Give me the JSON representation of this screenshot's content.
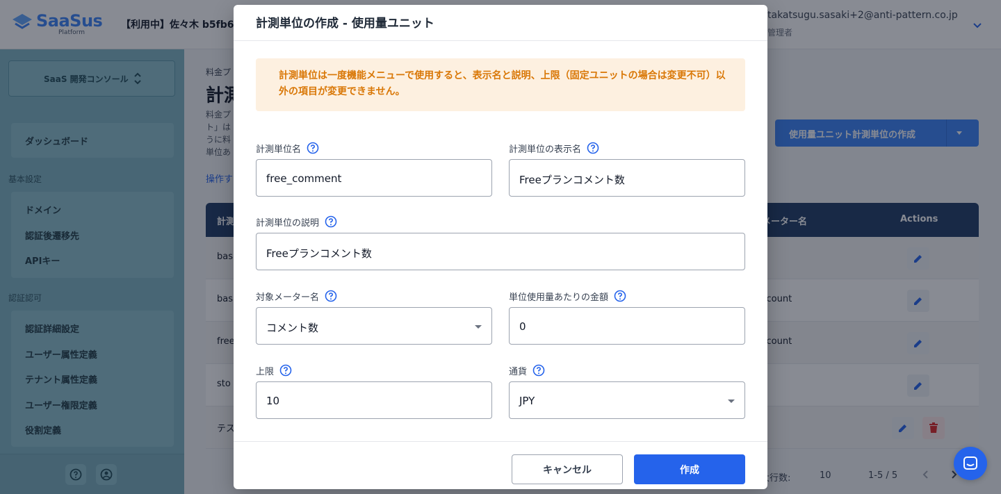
{
  "header": {
    "logo_text": "SaaSus",
    "logo_sub": "Platform",
    "tenant_label": "【利用中】佐々木 b5fb6",
    "user_email": "takatsugu.sasaki+2@anti-pattern.co.jp",
    "user_role": "管理者"
  },
  "sidebar": {
    "console_label": "SaaS 開発コンソール",
    "top_items": [
      "ダッシュボード"
    ],
    "section_basic": "基本設定",
    "basic_items": [
      "ドメイン",
      "認証後遷移先",
      "APIキー"
    ],
    "section_auth": "認証認可",
    "auth_items": [
      "認証詳細設定",
      "ユーザー属性定義",
      "テナント属性定義",
      "ユーザー権限定義",
      "役割定義"
    ]
  },
  "main": {
    "breadcrumb": "料金プ",
    "title": "計測",
    "description": "料金プ ト」は うに料 単位あ",
    "link": "操作す",
    "create_dropdown_label": "使用量ユニット計測単位の作成",
    "table": {
      "col1": "計測",
      "col2": "メーター名",
      "col3": "Actions",
      "rows": [
        {
          "c1": "bas",
          "c2": ""
        },
        {
          "c1": "bas",
          "c2": "_count"
        },
        {
          "c1": "free",
          "c2": "_count"
        },
        {
          "c1": "sto",
          "c2": ""
        },
        {
          "c1": "テス",
          "c2": ""
        }
      ]
    },
    "pager": {
      "rows_per_page_label": "最大行数:",
      "rows_per_page_value": "10",
      "range": "1-5 / 5"
    }
  },
  "modal": {
    "title": "計測単位の作成 - 使用量ユニット",
    "alert": "計測単位は一度機能メニューで使用すると、表示名と説明、上限（固定ユニットの場合は変更不可）以外の項目が変更できません。",
    "fields": {
      "unit_name": {
        "label": "計測単位名",
        "value": "free_comment"
      },
      "display_name": {
        "label": "計測単位の表示名",
        "value": "Freeプランコメント数"
      },
      "description": {
        "label": "計測単位の説明",
        "value": "Freeプランコメント数"
      },
      "meter_name": {
        "label": "対象メーター名",
        "value": "コメント数"
      },
      "unit_amount": {
        "label": "単位使用量あたりの金額",
        "value": "0"
      },
      "limit": {
        "label": "上限",
        "value": "10"
      },
      "currency": {
        "label": "通貨",
        "value": "JPY"
      }
    },
    "cancel_label": "キャンセル",
    "create_label": "作成"
  },
  "colors": {
    "primary": "#2563eb",
    "alert_bg": "#fdf0e0",
    "alert_text": "#d97706",
    "table_header": "#1e3a64"
  }
}
